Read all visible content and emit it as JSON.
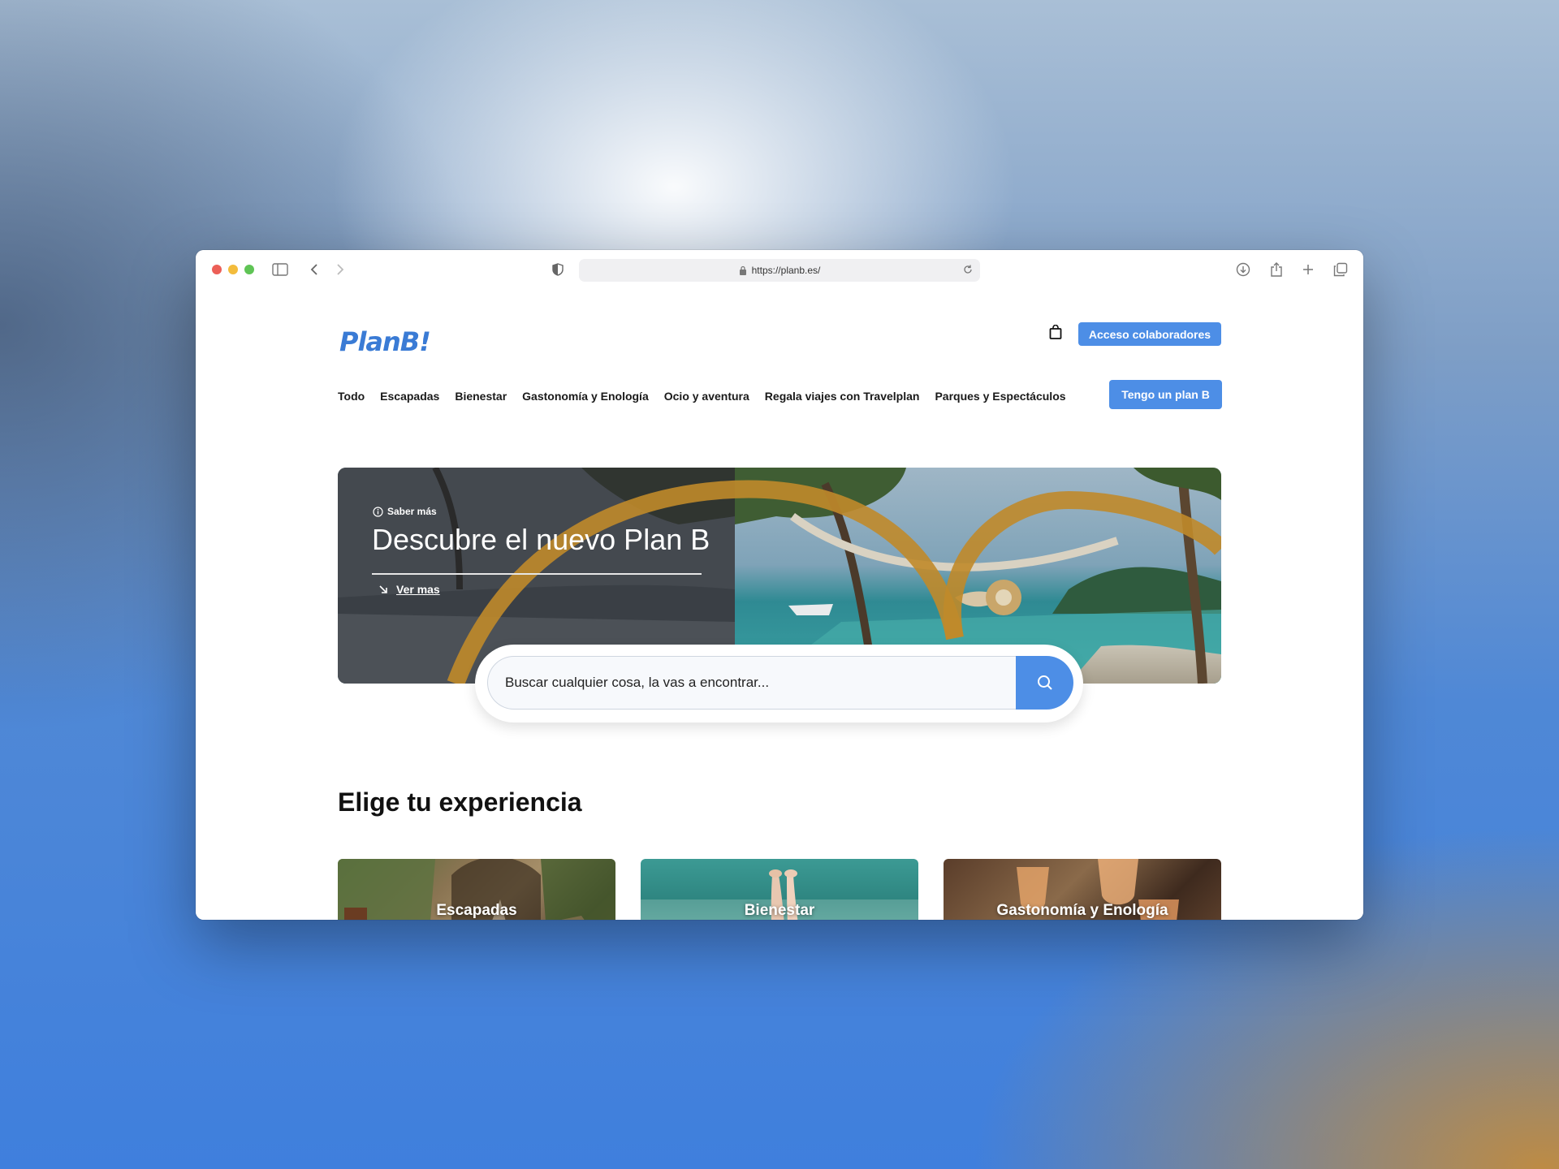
{
  "browser": {
    "url": "https://planb.es/"
  },
  "header": {
    "logo": "PlanB!",
    "partner_access_label": "Acceso colaboradores",
    "have_plan_label": "Tengo un plan B"
  },
  "nav": {
    "items": [
      "Todo",
      "Escapadas",
      "Bienestar",
      "Gastonomía y Enología",
      "Ocio y aventura",
      "Regala viajes con Travelplan",
      "Parques y Espectáculos"
    ]
  },
  "hero": {
    "saber_mas": "Saber más",
    "title": "Descubre el nuevo Plan B",
    "link": "Ver mas"
  },
  "search": {
    "placeholder": "Buscar cualquier cosa, la vas a encontrar..."
  },
  "experiences": {
    "title": "Elige tu experiencia",
    "cards": [
      "Escapadas",
      "Bienestar",
      "Gastonomía y Enología"
    ]
  },
  "colors": {
    "accent": "#4d8ee6",
    "logo": "#3a7bd5",
    "hero_ring": "#c08a2a"
  }
}
